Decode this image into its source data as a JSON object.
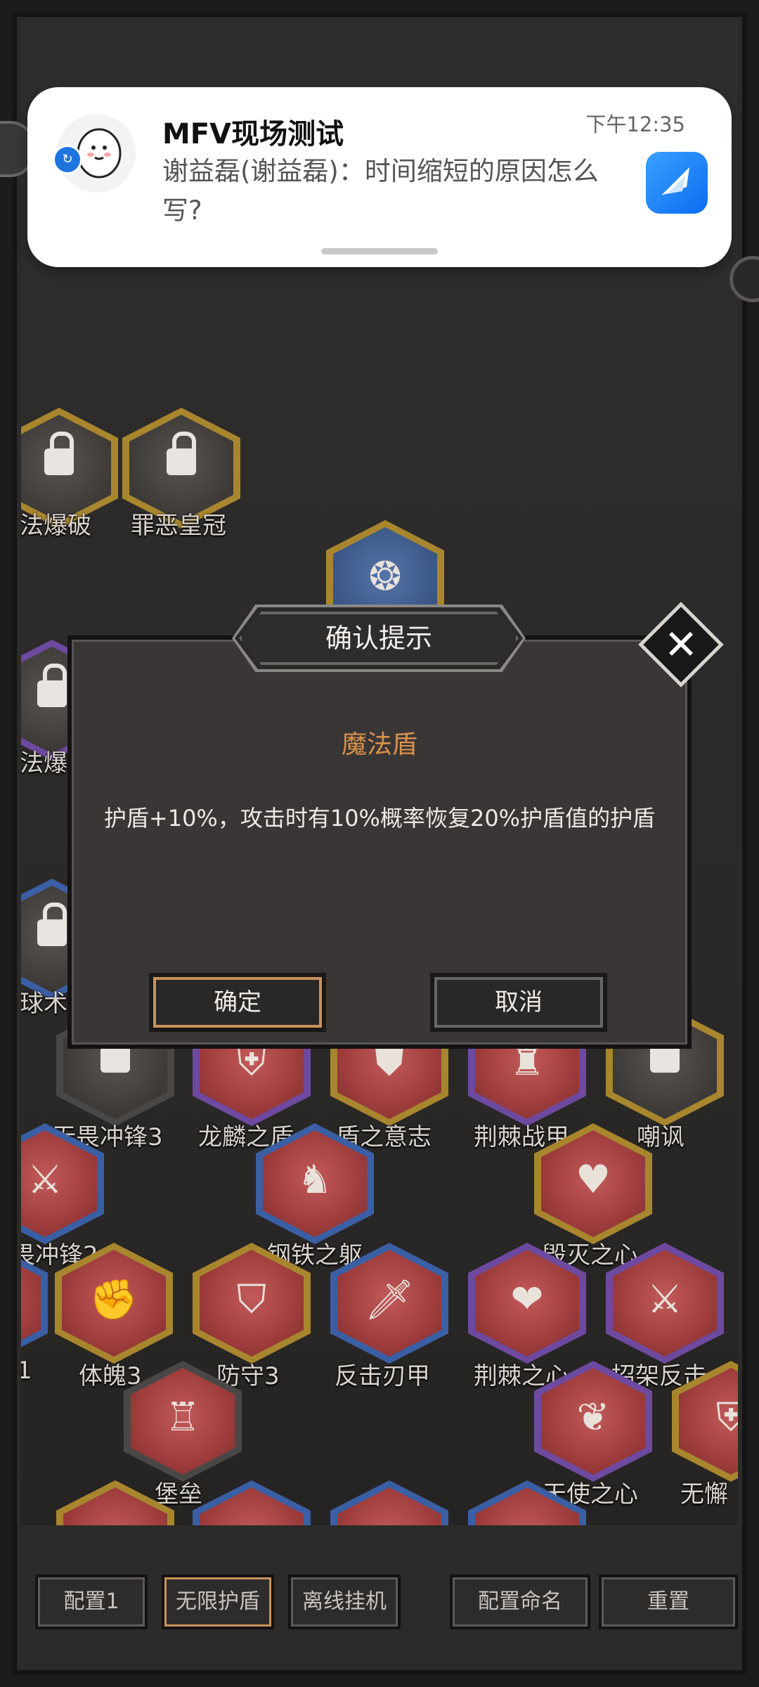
{
  "notification": {
    "title": "MFV现场测试",
    "time": "下午12:35",
    "message": "谢益磊(谢益磊)：时间缩短的原因怎么写?",
    "app_icon": "feather-app-icon"
  },
  "skills": [
    {
      "label": "法爆破"
    },
    {
      "label": "罪恶皇冠"
    },
    {
      "label": "法爆"
    },
    {
      "label": "球术"
    },
    {
      "label": "无畏冲锋3"
    },
    {
      "label": "龙麟之盾"
    },
    {
      "label": "盾之意志"
    },
    {
      "label": "荆棘战甲"
    },
    {
      "label": "嘲讽"
    },
    {
      "label": "畏冲锋2"
    },
    {
      "label": "钢铁之躯"
    },
    {
      "label": "毁灭之心"
    },
    {
      "label": "1"
    },
    {
      "label": "体魄3"
    },
    {
      "label": "防守3"
    },
    {
      "label": "反击刃甲"
    },
    {
      "label": "荆棘之心"
    },
    {
      "label": "招架反击"
    },
    {
      "label": "堡垒"
    },
    {
      "label": "天使之心"
    },
    {
      "label": "无懈"
    }
  ],
  "dialog": {
    "title": "确认提示",
    "skill_name": "魔法盾",
    "description": "护盾+10%，攻击时有10%概率恢复20%护盾值的护盾",
    "confirm_label": "确定",
    "cancel_label": "取消"
  },
  "bottom_bar": {
    "config1": "配置1",
    "infinite_shield": "无限护盾",
    "offline": "离线挂机",
    "rename": "配置命名",
    "reset": "重置"
  }
}
